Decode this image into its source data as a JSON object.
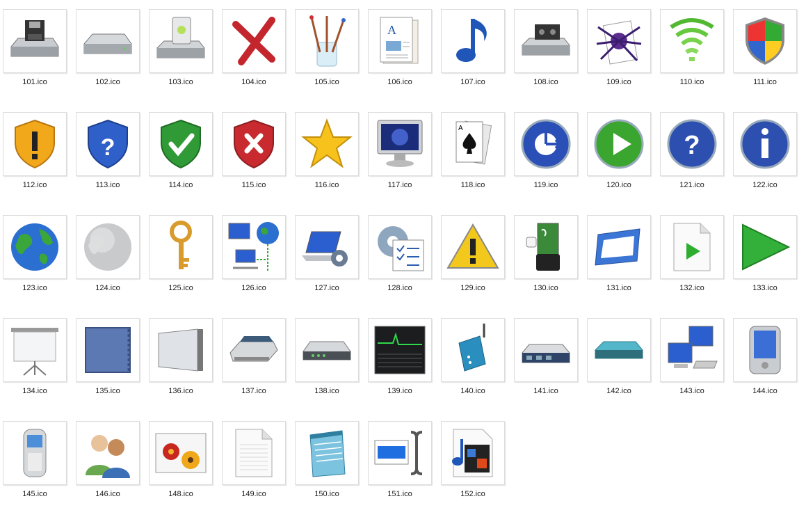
{
  "files": [
    {
      "name": "101.ico",
      "icon": "floppy-drive"
    },
    {
      "name": "102.ico",
      "icon": "hard-drive"
    },
    {
      "name": "103.ico",
      "icon": "drive-with-device"
    },
    {
      "name": "104.ico",
      "icon": "red-x"
    },
    {
      "name": "105.ico",
      "icon": "paint-brushes"
    },
    {
      "name": "106.ico",
      "icon": "document-notepad"
    },
    {
      "name": "107.ico",
      "icon": "music-note"
    },
    {
      "name": "108.ico",
      "icon": "tape-drive"
    },
    {
      "name": "109.ico",
      "icon": "spider-solitaire"
    },
    {
      "name": "110.ico",
      "icon": "wireless-signal"
    },
    {
      "name": "111.ico",
      "icon": "windows-security-shield"
    },
    {
      "name": "112.ico",
      "icon": "warning-shield"
    },
    {
      "name": "113.ico",
      "icon": "question-shield"
    },
    {
      "name": "114.ico",
      "icon": "check-shield"
    },
    {
      "name": "115.ico",
      "icon": "error-shield"
    },
    {
      "name": "116.ico",
      "icon": "star"
    },
    {
      "name": "117.ico",
      "icon": "monitor"
    },
    {
      "name": "118.ico",
      "icon": "playing-cards"
    },
    {
      "name": "119.ico",
      "icon": "blue-circle-arrows"
    },
    {
      "name": "120.ico",
      "icon": "green-play-circle"
    },
    {
      "name": "121.ico",
      "icon": "help-circle"
    },
    {
      "name": "122.ico",
      "icon": "info-circle"
    },
    {
      "name": "123.ico",
      "icon": "globe"
    },
    {
      "name": "124.ico",
      "icon": "grey-globe"
    },
    {
      "name": "125.ico",
      "icon": "key"
    },
    {
      "name": "126.ico",
      "icon": "network-globe"
    },
    {
      "name": "127.ico",
      "icon": "laptop-gear"
    },
    {
      "name": "128.ico",
      "icon": "gear-checklist"
    },
    {
      "name": "129.ico",
      "icon": "warning-triangle"
    },
    {
      "name": "130.ico",
      "icon": "smart-card"
    },
    {
      "name": "131.ico",
      "icon": "window-frame"
    },
    {
      "name": "132.ico",
      "icon": "media-file"
    },
    {
      "name": "133.ico",
      "icon": "green-play-arrow"
    },
    {
      "name": "134.ico",
      "icon": "projector-screen"
    },
    {
      "name": "135.ico",
      "icon": "blue-panel"
    },
    {
      "name": "136.ico",
      "icon": "metal-panel"
    },
    {
      "name": "137.ico",
      "icon": "scanner"
    },
    {
      "name": "138.ico",
      "icon": "modem"
    },
    {
      "name": "139.ico",
      "icon": "performance-monitor"
    },
    {
      "name": "140.ico",
      "icon": "router-antenna"
    },
    {
      "name": "141.ico",
      "icon": "network-switch"
    },
    {
      "name": "142.ico",
      "icon": "teal-modem"
    },
    {
      "name": "143.ico",
      "icon": "networked-computers"
    },
    {
      "name": "144.ico",
      "icon": "pda"
    },
    {
      "name": "145.ico",
      "icon": "mobile-phone"
    },
    {
      "name": "146.ico",
      "icon": "users"
    },
    {
      "name": "148.ico",
      "icon": "photo-flowers"
    },
    {
      "name": "149.ico",
      "icon": "blank-document"
    },
    {
      "name": "150.ico",
      "icon": "notepad"
    },
    {
      "name": "151.ico",
      "icon": "text-cursor-field"
    },
    {
      "name": "152.ico",
      "icon": "video-file"
    }
  ]
}
